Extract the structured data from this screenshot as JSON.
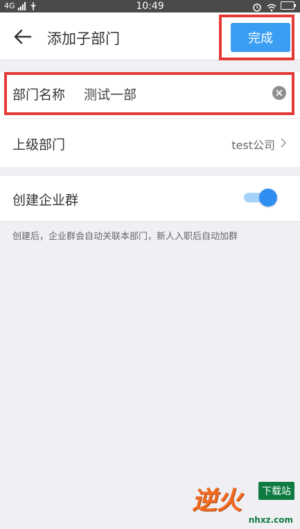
{
  "status_bar": {
    "network": "4G",
    "time": "10:49",
    "icons": [
      "signal-icon",
      "usb-icon",
      "alarm-icon",
      "wifi-icon",
      "battery-icon"
    ]
  },
  "header": {
    "title": "添加子部门",
    "done_label": "完成",
    "back_icon": "arrow-left-icon"
  },
  "department_name": {
    "label": "部门名称",
    "value": "测试一部",
    "clear_icon": "clear-icon"
  },
  "parent_department": {
    "label": "上级部门",
    "value": "test公司",
    "chevron_icon": "chevron-right-icon"
  },
  "create_group": {
    "label": "创建企业群",
    "enabled": true,
    "note": "创建后，企业群会自动关联本部门，新人入职后自动加群"
  },
  "watermark": {
    "brand": "逆火",
    "badge": "下载站",
    "domain": "nhxz.com"
  },
  "colors": {
    "accent": "#3a9ff3",
    "highlight": "#e53935",
    "background": "#efeff4",
    "toggle_on": "#2f8ef2"
  }
}
